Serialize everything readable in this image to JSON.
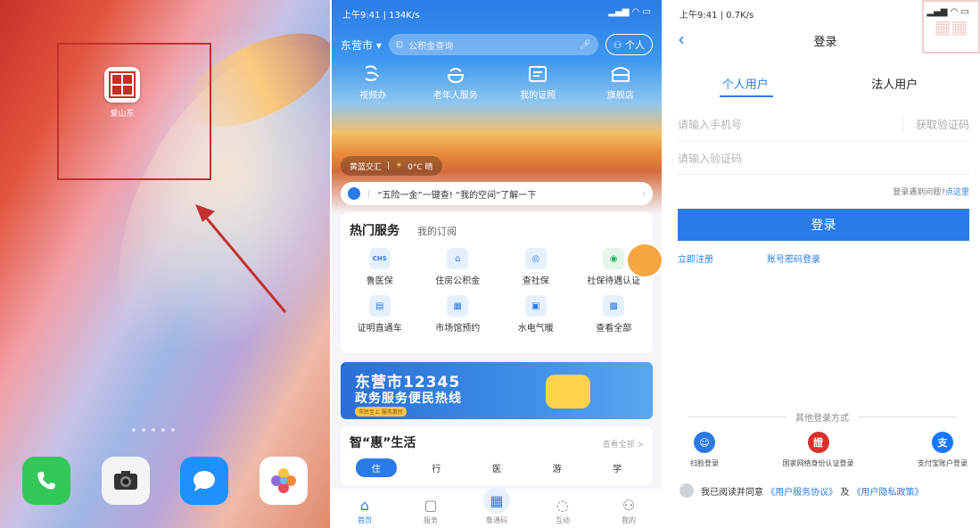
{
  "home_screen": {
    "app_label": "爱山东",
    "dock_icons": [
      "phone-icon",
      "camera-icon",
      "messages-icon",
      "photos-icon"
    ]
  },
  "app_home": {
    "status_left": "上午9:41 | 134K/s",
    "city": "东营市",
    "search_placeholder": "公积金查询",
    "personal_label": "个人",
    "top_icons": [
      {
        "icon": "video-office-icon",
        "label": "视频办"
      },
      {
        "icon": "elderly-service-icon",
        "label": "老年人服务"
      },
      {
        "icon": "id-card-icon",
        "label": "我的证照"
      },
      {
        "icon": "store-icon",
        "label": "旗舰店"
      }
    ],
    "weather": "黄蓝交汇",
    "weather_temp": "0°C 晴",
    "notice": "“五险一金”一键查! “我的空间”了解一下",
    "hot_services_title": "热门服务",
    "my_subscription": "我的订阅",
    "services": [
      {
        "icon": "chs-icon",
        "label": "鲁医保"
      },
      {
        "icon": "house-fund-icon",
        "label": "住房公积金"
      },
      {
        "icon": "social-security-icon",
        "label": "查社保"
      },
      {
        "icon": "certification-icon",
        "label": "社保待遇认证"
      },
      {
        "icon": "certificate-icon",
        "label": "证明直通车"
      },
      {
        "icon": "venue-icon",
        "label": "市场馆预约"
      },
      {
        "icon": "utilities-icon",
        "label": "水电气暖"
      },
      {
        "icon": "all-icon",
        "label": "查看全部"
      }
    ],
    "banner_title": "东营市12345",
    "banner_subtitle": "政务服务便民热线",
    "banner_tag": "市民至上 服务惠民",
    "life_title": "智“惠”生活",
    "life_more": "查看全部 >",
    "life_tabs": [
      "住",
      "行",
      "医",
      "游",
      "学"
    ],
    "tabbar": [
      {
        "icon": "home-icon",
        "label": "首页"
      },
      {
        "icon": "service-icon",
        "label": "服务"
      },
      {
        "icon": "lu-code-icon",
        "label": "鲁通码"
      },
      {
        "icon": "interact-icon",
        "label": "互动"
      },
      {
        "icon": "profile-icon",
        "label": "我的"
      }
    ]
  },
  "login": {
    "status_left": "上午9:41 | 0.7K/s",
    "title": "登录",
    "tab_personal": "个人用户",
    "tab_corporate": "法人用户",
    "phone_placeholder": "请输入手机号",
    "get_code": "获取验证码",
    "code_placeholder": "请输入验证码",
    "help_prefix": "登录遇到问题?",
    "help_link": "点这里",
    "login_button": "登录",
    "register": "立即注册",
    "password_login": "账号密码登录",
    "other_methods": "其他登录方式",
    "methods": [
      {
        "icon": "face-scan-icon",
        "label": "扫脸登录",
        "color": "#2a7be8"
      },
      {
        "icon": "national-id-icon",
        "label": "国家网络身份认证登录",
        "color": "#d9302c"
      },
      {
        "icon": "alipay-icon",
        "label": "支付宝账户登录",
        "color": "#1677ff"
      }
    ],
    "agree_prefix": "我已阅读并同意",
    "agreement": "《用户服务协议》",
    "and": "及",
    "privacy": "《用户隐私政策》"
  }
}
